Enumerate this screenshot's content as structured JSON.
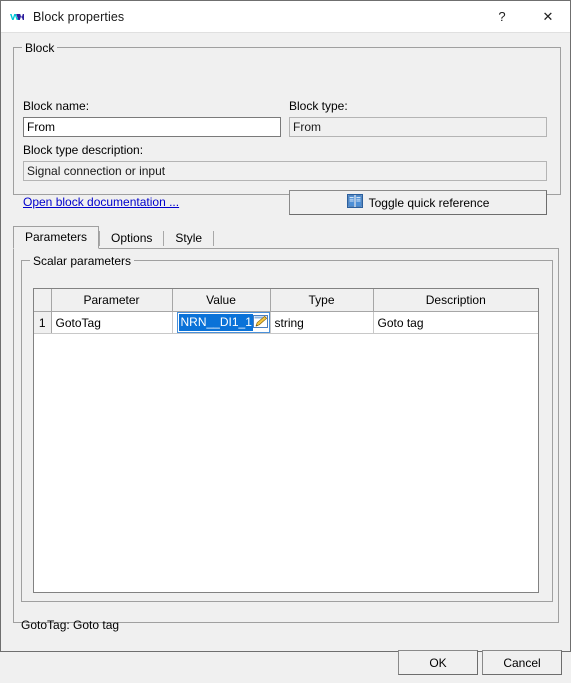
{
  "window": {
    "title": "Block properties",
    "icon": "app-logo-icon",
    "help_glyph": "?",
    "close_glyph": "✕"
  },
  "block_group": {
    "legend": "Block",
    "name_label": "Block name:",
    "name_value": "From",
    "type_label": "Block type:",
    "type_value": "From",
    "description_label": "Block type description:",
    "description_value": "Signal connection or input",
    "doc_link": "Open block documentation ...",
    "toggle_button": "Toggle quick reference",
    "toggle_icon": "book-icon"
  },
  "tabs": [
    {
      "label": "Parameters",
      "selected": true
    },
    {
      "label": "Options",
      "selected": false
    },
    {
      "label": "Style",
      "selected": false
    }
  ],
  "scalar_group": {
    "legend": "Scalar parameters",
    "columns": [
      "",
      "Parameter",
      "Value",
      "Type",
      "Description"
    ],
    "rows": [
      {
        "index": "1",
        "parameter": "GotoTag",
        "value": "NRN__DI1_1",
        "value_selected": true,
        "value_icon": "edit-pencil-icon",
        "type": "string",
        "description": "Goto tag"
      }
    ]
  },
  "status_line": "GotoTag: Goto tag",
  "buttons": {
    "ok": "OK",
    "cancel": "Cancel"
  },
  "colors": {
    "dialog_bg": "#f0f0f0",
    "titlebar_bg": "#ffffff",
    "link": "#0000cc",
    "selection": "#0a72d8",
    "logo_cyan": "#00c8d7",
    "logo_blue": "#3a1fa0",
    "accent_border": "#4a90d9"
  }
}
